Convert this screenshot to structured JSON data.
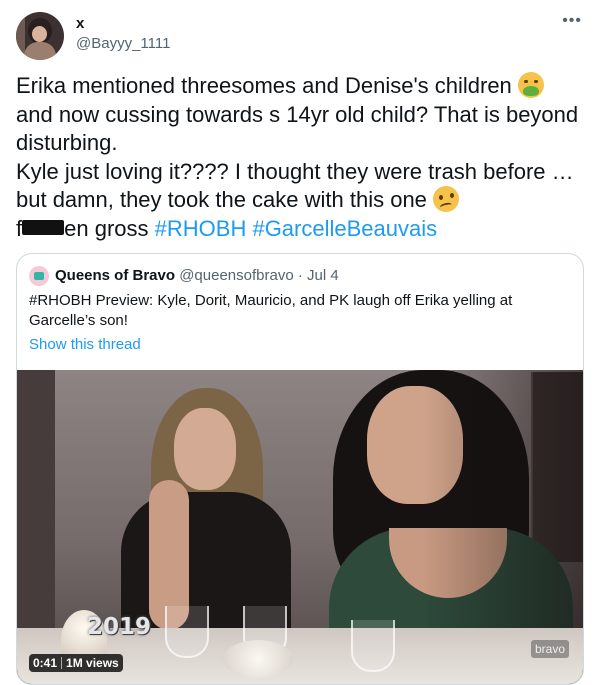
{
  "tweet": {
    "author_name": "x",
    "author_handle": "@Bayyy_1111",
    "more_icon": "more-options-icon",
    "line1": "Erika mentioned threesomes and Denise's children",
    "line2": "and now cussing towards s 14yr old child? That is beyond disturbing.",
    "line3": "Kyle just loving it???? I thought they were trash before … but damn, they  took the cake with this one",
    "line4_prefix": "f",
    "line4_suffix": "en gross",
    "hashtag1": "#RHOBH",
    "hashtag2": "#GarcelleBeauvais",
    "emoji1": "nauseated-face-icon",
    "emoji2": "woozy-face-icon",
    "accent_color": "#1d9bf0"
  },
  "quote": {
    "name": "Queens of Bravo",
    "handle": "@queensofbravo",
    "dot": "·",
    "date": "Jul 4",
    "text": "#RHOBH Preview: Kyle, Dorit, Mauricio, and PK laugh off Erika yelling at Garcelle’s son!",
    "thread_link": "Show this thread"
  },
  "video": {
    "year_badge": "2019",
    "watermark": "bravo",
    "time": "0:41",
    "views": "1M views"
  }
}
